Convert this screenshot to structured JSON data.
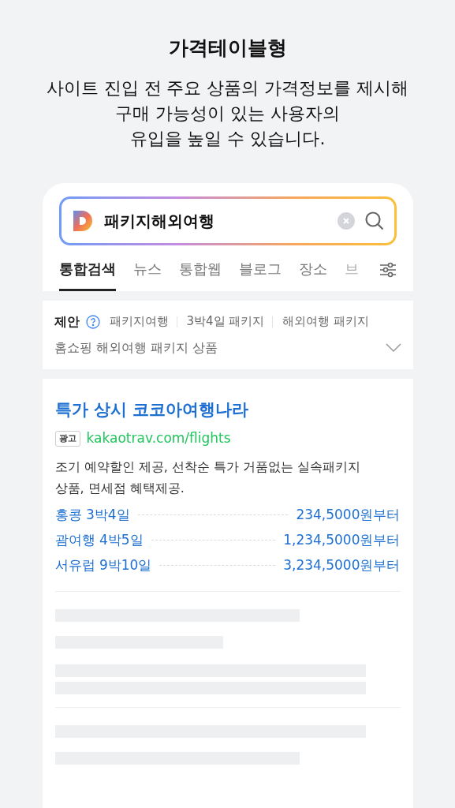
{
  "heading": "가격테이블형",
  "description": [
    "사이트 진입 전 주요 상품의 가격정보를 제시해",
    "구매 가능성이 있는 사용자의",
    "유입을 높일 수 있습니다."
  ],
  "search": {
    "value": "패키지해외여행"
  },
  "tabs": [
    {
      "label": "통합검색",
      "selected": true
    },
    {
      "label": "뉴스",
      "selected": false
    },
    {
      "label": "통합웹",
      "selected": false
    },
    {
      "label": "블로그",
      "selected": false
    },
    {
      "label": "장소",
      "selected": false
    },
    {
      "label": "브",
      "selected": false
    }
  ],
  "suggestions": {
    "label": "제안",
    "items": [
      "패키지여행",
      "3박4일 패키지",
      "해외여행 패키지",
      "홈쇼핑 해외여행 패키지 상품"
    ],
    "expanded": false
  },
  "ad": {
    "title": "특가 상시 코코아여행나라",
    "badge": "광고",
    "url": "kakaotrav.com/flights",
    "text": "조기 예약할인 제공, 선착순 특가 거품없는 실속패키지 상품, 면세점 혜택제공.",
    "prices": [
      {
        "name": "홍콩 3박4일",
        "price": "234,5000원부터"
      },
      {
        "name": "괌여행 4박5일",
        "price": "1,234,5000원부터"
      },
      {
        "name": "서유럽 9박10일",
        "price": "3,234,5000원부터"
      }
    ]
  }
}
